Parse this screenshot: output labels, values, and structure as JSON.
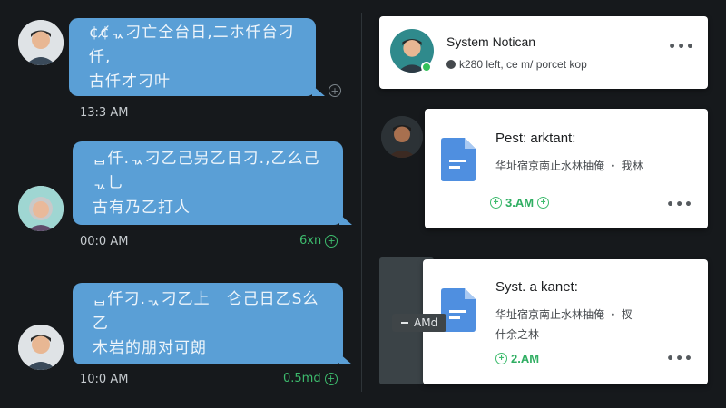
{
  "chat": {
    "messages": [
      {
        "text_line1": "¢¢̸ᆪ刁亡仝台日,二ホ仟台刁仟,",
        "text_line2": "古仟才刁叶",
        "time": "13:3 AM",
        "status": ""
      },
      {
        "text_line1": "ᆸ仟.ᆪ刁乙己另乙日刁.,乙么己ᆪ乚",
        "text_line2": "古有乃乙打人",
        "time": "00:0 AM",
        "status": "6xn"
      },
      {
        "text_line1": "ᆸ仟刁.ᆪ刁乙上　仑己日乙S么乙",
        "text_line2": "木岩的朋对可朗",
        "time": "10:0 AM",
        "status": "0.5md"
      }
    ]
  },
  "notifications": {
    "system": {
      "title": "System Notican",
      "subtitle": "k280 left, ce m/ porcet kop",
      "more": "•••"
    },
    "cards": [
      {
        "title": "Pest: arktant:",
        "body_line1": "华址宿京南止水林抽俺 ・ 我林",
        "body_line2": "",
        "time": "3.AM",
        "more": "•••"
      },
      {
        "title": "Syst. a kanet:",
        "body_line1": "华址宿京南止水林抽俺 ・ 杈",
        "body_line2": "什余之林",
        "time": "2.AM",
        "more": "•••"
      }
    ],
    "pill": {
      "label": "AMd"
    }
  },
  "colors": {
    "bubble": "#5a9fd6",
    "accent_green": "#3dbb6d",
    "background": "#16191c",
    "doc_icon": "#4f8fe0"
  },
  "icons": [
    "avatar-man",
    "avatar-older-woman",
    "add-circle-icon",
    "document-icon",
    "more-horiz-icon",
    "online-status-dot"
  ]
}
